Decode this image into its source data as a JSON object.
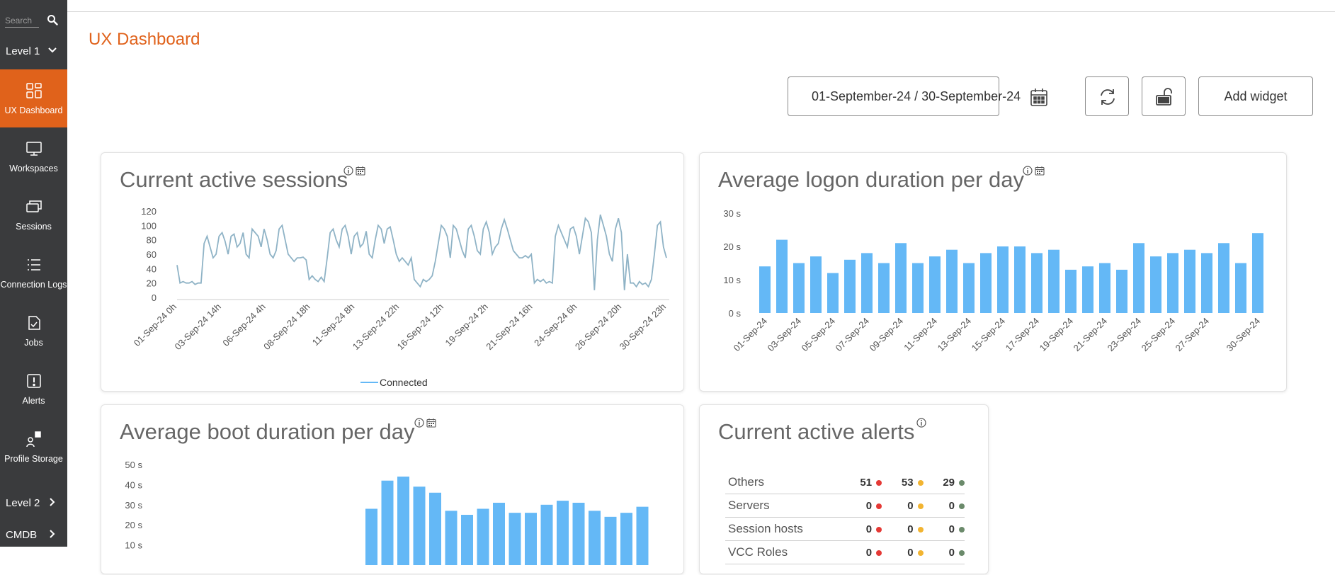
{
  "sidebar": {
    "search_placeholder": "Search",
    "level1_label": "Level 1",
    "items": [
      {
        "label": "UX Dashboard",
        "icon": "dashboard-grid-icon",
        "active": true
      },
      {
        "label": "Workspaces",
        "icon": "monitor-icon"
      },
      {
        "label": "Sessions",
        "icon": "windows-stack-icon"
      },
      {
        "label": "Connection Logs",
        "icon": "list-icon"
      },
      {
        "label": "Jobs",
        "icon": "clipboard-check-icon"
      },
      {
        "label": "Alerts",
        "icon": "alert-exclamation-icon"
      },
      {
        "label": "Profile Storage",
        "icon": "profile-storage-icon"
      }
    ],
    "level2_label": "Level 2",
    "cmdb_label": "CMDB"
  },
  "header": {
    "title": "UX Dashboard",
    "date_range": "01-September-24 / 30-September-24",
    "add_widget_label": "Add widget"
  },
  "colors": {
    "accent": "#e0621b",
    "sidebar_bg": "#3a3b3d",
    "bar": "#64b8f6",
    "line": "#8fb3c6",
    "alert_red": "#e53935",
    "alert_yellow": "#f2b431",
    "alert_gray": "#6b8a6b"
  },
  "widgets": {
    "sessions": {
      "title": "Current active sessions"
    },
    "logon": {
      "title": "Average logon duration per day"
    },
    "boot": {
      "title": "Average boot duration per day"
    },
    "alerts": {
      "title": "Current active alerts",
      "rows": [
        {
          "name": "Others",
          "red": "51",
          "yellow": "53",
          "gray": "29"
        },
        {
          "name": "Servers",
          "red": "0",
          "yellow": "0",
          "gray": "0"
        },
        {
          "name": "Session hosts",
          "red": "0",
          "yellow": "0",
          "gray": "0"
        },
        {
          "name": "VCC Roles",
          "red": "0",
          "yellow": "0",
          "gray": "0"
        }
      ]
    }
  },
  "chart_data": [
    {
      "type": "line",
      "title": "Current active sessions",
      "ylim": [
        0,
        120
      ],
      "y_ticks": [
        "0",
        "20",
        "40",
        "60",
        "80",
        "100",
        "120"
      ],
      "x_ticks": [
        "01-Sep-24 0h",
        "03-Sep-24 14h",
        "06-Sep-24 4h",
        "08-Sep-24 18h",
        "11-Sep-24 8h",
        "13-Sep-24 22h",
        "16-Sep-24 12h",
        "19-Sep-24 2h",
        "21-Sep-24 16h",
        "24-Sep-24 6h",
        "26-Sep-24 20h",
        "30-Sep-24 23h"
      ],
      "series": [
        {
          "name": "Connected",
          "values": [
            45,
            20,
            22,
            20,
            20,
            22,
            18,
            20,
            20,
            75,
            85,
            70,
            55,
            60,
            85,
            90,
            78,
            60,
            85,
            88,
            70,
            75,
            90,
            60,
            55,
            95,
            90,
            85,
            70,
            95,
            80,
            60,
            55,
            65,
            95,
            100,
            80,
            60,
            55,
            50,
            55,
            55,
            56,
            52,
            25,
            30,
            25,
            22,
            28,
            22,
            55,
            90,
            95,
            80,
            70,
            95,
            100,
            85,
            60,
            85,
            90,
            70,
            75,
            92,
            60,
            55,
            80,
            100,
            95,
            75,
            95,
            98,
            80,
            60,
            50,
            55,
            50,
            45,
            55,
            25,
            20,
            15,
            25,
            22,
            25,
            30,
            50,
            75,
            100,
            95,
            85,
            55,
            100,
            95,
            80,
            65,
            55,
            95,
            100,
            85,
            65,
            60,
            95,
            105,
            90,
            60,
            70,
            75,
            95,
            108,
            95,
            80,
            65,
            60,
            55,
            55,
            58,
            55,
            60,
            20,
            25,
            22,
            25,
            20,
            22,
            20,
            85,
            100,
            90,
            80,
            70,
            95,
            98,
            85,
            60,
            85,
            110,
            105,
            90,
            10,
            80,
            115,
            100,
            85,
            60,
            50,
            95,
            110,
            90,
            10,
            60,
            20,
            20,
            15,
            22,
            18,
            20,
            15,
            25,
            60,
            100,
            105,
            70,
            55
          ]
        }
      ]
    },
    {
      "type": "bar",
      "title": "Average logon duration per day",
      "ylim": [
        0,
        30
      ],
      "y_ticks": [
        "0 s",
        "10 s",
        "20 s",
        "30 s"
      ],
      "categories": [
        "01-Sep-24",
        "02-Sep-24",
        "03-Sep-24",
        "04-Sep-24",
        "05-Sep-24",
        "06-Sep-24",
        "07-Sep-24",
        "08-Sep-24",
        "09-Sep-24",
        "10-Sep-24",
        "11-Sep-24",
        "12-Sep-24",
        "13-Sep-24",
        "14-Sep-24",
        "15-Sep-24",
        "16-Sep-24",
        "17-Sep-24",
        "18-Sep-24",
        "19-Sep-24",
        "20-Sep-24",
        "21-Sep-24",
        "22-Sep-24",
        "23-Sep-24",
        "24-Sep-24",
        "25-Sep-24",
        "26-Sep-24",
        "27-Sep-24",
        "28-Sep-24",
        "29-Sep-24",
        "30-Sep-24"
      ],
      "x_tick_labels": [
        "01-Sep-24",
        "03-Sep-24",
        "05-Sep-24",
        "07-Sep-24",
        "09-Sep-24",
        "11-Sep-24",
        "13-Sep-24",
        "15-Sep-24",
        "17-Sep-24",
        "19-Sep-24",
        "21-Sep-24",
        "23-Sep-24",
        "25-Sep-24",
        "27-Sep-24",
        "30-Sep-24"
      ],
      "values": [
        14,
        22,
        15,
        17,
        12,
        16,
        18,
        15,
        21,
        15,
        17,
        19,
        15,
        18,
        20,
        20,
        18,
        19,
        13,
        14,
        15,
        13,
        21,
        17,
        18,
        19,
        18,
        21,
        15,
        24
      ]
    },
    {
      "type": "bar",
      "title": "Average boot duration per day",
      "ylim": [
        0,
        50
      ],
      "y_ticks": [
        "10 s",
        "20 s",
        "30 s",
        "40 s",
        "50 s"
      ],
      "values": [
        28,
        42,
        44,
        39,
        36,
        27,
        25,
        28,
        31,
        26,
        26,
        30,
        32,
        31,
        27,
        24,
        26,
        29
      ]
    }
  ]
}
